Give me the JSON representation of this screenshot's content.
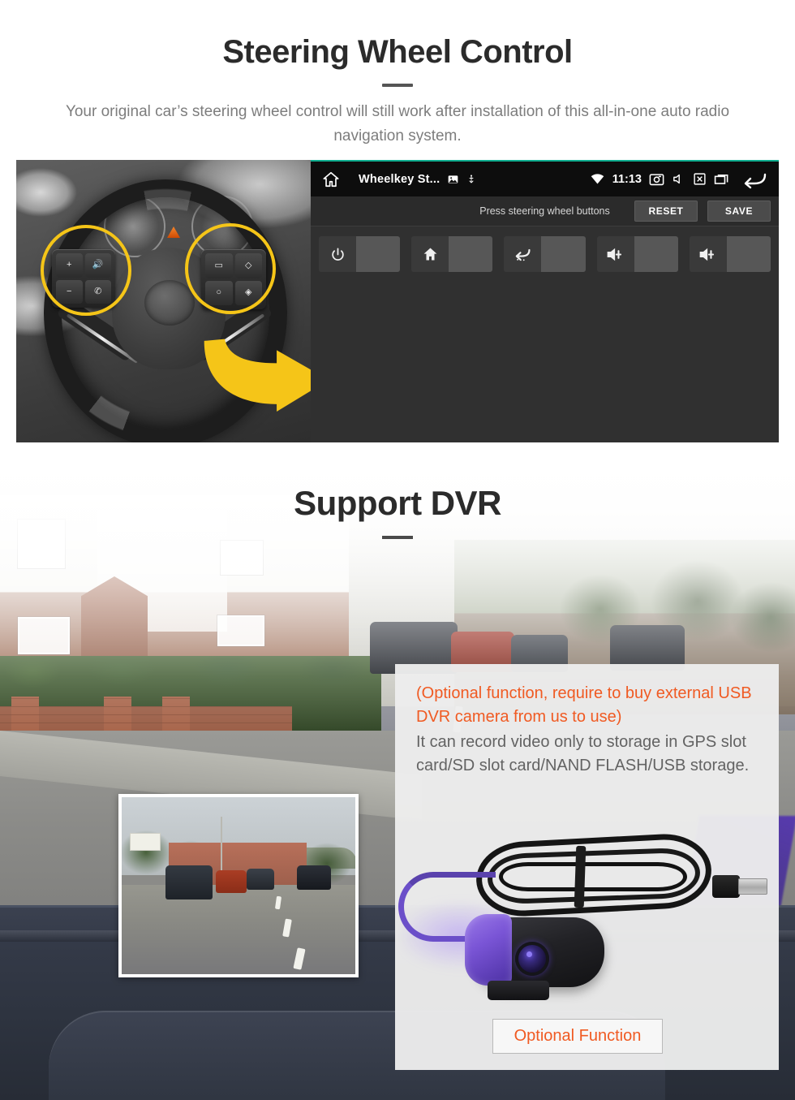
{
  "steering_section": {
    "title": "Steering Wheel Control",
    "description": "Your original car’s steering wheel control will still work after installation of this all-in-one auto radio navigation system.",
    "android_ui": {
      "statusbar": {
        "app_title": "Wheelkey St...",
        "time": "11:13",
        "icons": [
          "home-icon",
          "gallery-icon",
          "usb-icon",
          "wifi-icon",
          "camera-icon",
          "mute-icon",
          "sdcard-icon",
          "recents-icon",
          "back-icon"
        ]
      },
      "toolbar": {
        "hint": "Press steering wheel buttons",
        "reset_label": "RESET",
        "save_label": "SAVE"
      },
      "tiles": [
        {
          "icon": "power-icon",
          "glyph": "⏻",
          "value": ""
        },
        {
          "icon": "home-icon",
          "glyph": "⌂",
          "value": ""
        },
        {
          "icon": "back-icon",
          "glyph": "↩",
          "value": ""
        },
        {
          "icon": "volume-up-icon",
          "glyph": "🔊+",
          "value": ""
        },
        {
          "icon": "volume-up-icon",
          "glyph": "🔊+",
          "value": ""
        }
      ]
    },
    "photo": {
      "alt": "Steering wheel with highlighted control button clusters",
      "highlight_color": "#f5c518",
      "arrow_color": "#f5c518",
      "left_pad_keys": [
        "+",
        "−",
        "🔊",
        "✆"
      ],
      "right_pad_keys": [
        "▭",
        "◇",
        "○",
        "◈"
      ]
    }
  },
  "dvr_section": {
    "title": "Support DVR",
    "panel": {
      "optional_note": "(Optional function, require to buy external USB DVR camera from us to use)",
      "body": "It can record video only to storage in GPS slot card/SD slot card/NAND FLASH/USB storage.",
      "optional_button": "Optional Function",
      "orange_color": "#f05a22",
      "body_color": "#636363"
    },
    "inset_photo_alt": "Dashcam recorded street view",
    "product_photo_alt": "USB DVR camera with coiled cable and USB connector"
  }
}
